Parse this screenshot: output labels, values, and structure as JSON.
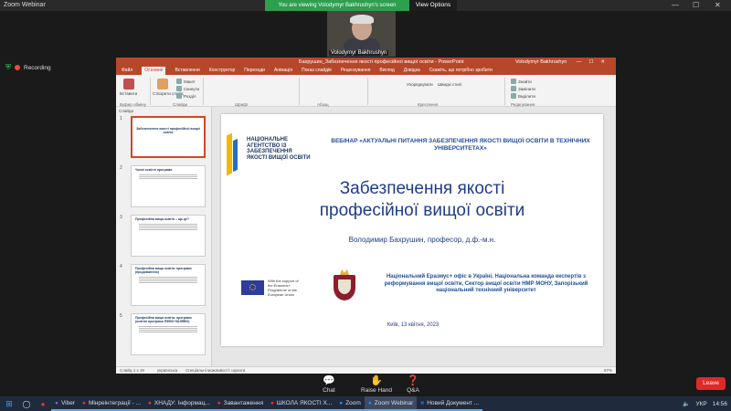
{
  "zoom": {
    "window_title": "Zoom Webinar",
    "view_banner": "You are viewing Volodymyr Bakhrushyn's screen",
    "view_options": "View Options",
    "camera_name": "Volodymyr Bakhrushyn",
    "recording_label": "Recording",
    "controls": {
      "chat": "Chat",
      "raise_hand": "Raise Hand",
      "qa": "Q&A"
    },
    "leave": "Leave"
  },
  "ppt": {
    "title": "Бахрушин_Забезпечення якості професійної вищої освіти - PowerPoint",
    "user": "Volodymyr Bakhrushyn",
    "menu": [
      "Файл",
      "Основне",
      "Вставлення",
      "Конструктор",
      "Переходи",
      "Анімація",
      "Показ слайдів",
      "Рецензування",
      "Вигляд",
      "Довідка",
      "Скажіть, що потрібно зробити"
    ],
    "ribbon": {
      "groups": [
        "Буфер обміну",
        "Слайди",
        "Шрифт",
        "Абзац",
        "Креслення",
        "Редагування"
      ],
      "buttons": [
        "Вставити",
        "Створити слайд",
        "Макет",
        "Скинути",
        "Розділ",
        "Упорядкувати",
        "Швидкі стилі",
        "Знайти",
        "Замінити",
        "Виділити"
      ]
    },
    "thumbs_header": "Слайди",
    "thumbnails": [
      {
        "num": "1",
        "title": "Забезпечення якості професійної вищої освіти"
      },
      {
        "num": "2",
        "title": "Чинні освітні програми"
      },
      {
        "num": "3",
        "title": "Професійна вища освіта – що це?"
      },
      {
        "num": "4",
        "title": "Професійна вища освіта: програми (продовження)"
      },
      {
        "num": "5",
        "title": "Професійна вища освіта: програми (освітні програми ПФВО НАЗЯВО)"
      }
    ],
    "slide": {
      "agency": "НАЦІОНАЛЬНЕ АГЕНТСТВО ІЗ ЗАБЕЗПЕЧЕННЯ ЯКОСТІ ВИЩОЇ ОСВІТИ",
      "heading": "ВЕБІНАР «АКТУАЛЬНІ ПИТАННЯ ЗАБЕЗПЕЧЕННЯ ЯКОСТІ ВИЩОЇ ОСВІТИ В ТЕХНІЧНИХ УНІВЕРСИТЕТАХ»",
      "title_line1": "Забезпечення якості",
      "title_line2": "професійної вищої освіти",
      "author": "Володимир Бахрушин, професор, д.ф.-м.н.",
      "eu_text": "With the support of the Erasmus+ Programme of the European Union",
      "office": "Національний Еразмус+ офіс в Україні, Національна команда експертів з реформування вищої освіти, Сектор вищої освіти НМР МОНУ, Запорізький національний технічний університет",
      "date": "Київ, 13 квітня, 2023"
    },
    "status": {
      "slide": "Слайд 1 з 19",
      "lang": "українська",
      "access": "Спеціальні можливості: шукати",
      "zoom": "67%"
    }
  },
  "taskbar": {
    "apps": [
      "Viber",
      "Мінреінтеграції - ...",
      "ХНАДУ: Інформац...",
      "Завантаження",
      "ШКОЛА ЯКОСТІ Х...",
      "Zoom",
      "Zoom Webinar",
      "Новий Документ ..."
    ],
    "lang": "УКР",
    "time": "14:56"
  }
}
